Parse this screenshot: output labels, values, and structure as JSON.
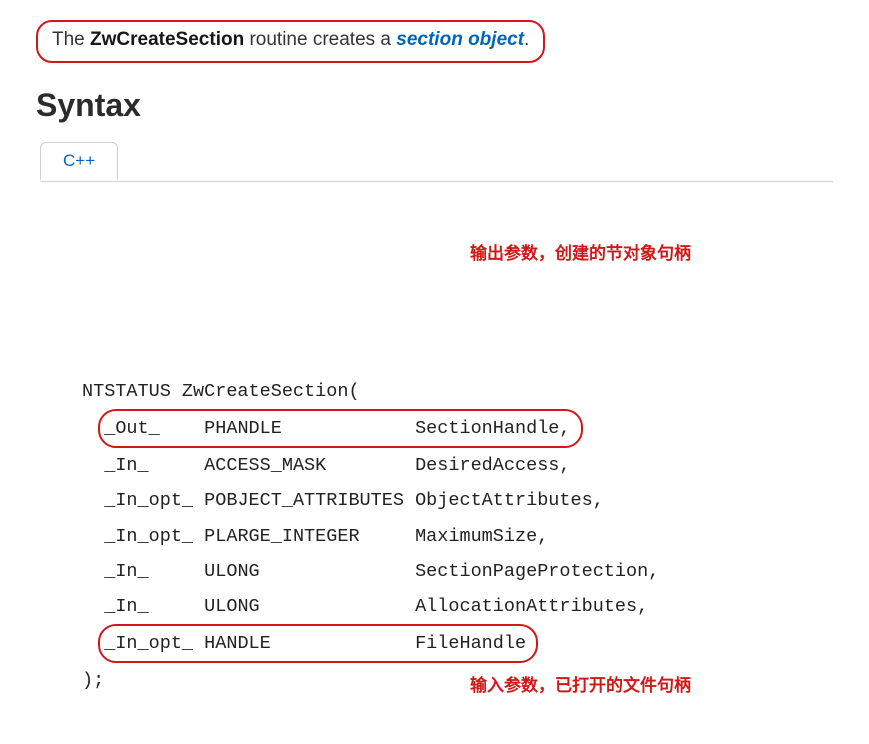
{
  "intro": {
    "pre": "The ",
    "api": "ZwCreateSection",
    "mid": " routine creates a ",
    "link": "section object",
    "post": "."
  },
  "syntax_heading": "Syntax",
  "tab": "C++",
  "sig": {
    "decl": "NTSTATUS ZwCreateSection(",
    "close": ");",
    "params": [
      {
        "annot": "_Out_   ",
        "type": "PHANDLE           ",
        "name": "SectionHandle,",
        "hl": true
      },
      {
        "annot": "_In_    ",
        "type": "ACCESS_MASK       ",
        "name": "DesiredAccess,",
        "hl": false
      },
      {
        "annot": "_In_opt_",
        "type": "POBJECT_ATTRIBUTES",
        "name": "ObjectAttributes,",
        "hl": false
      },
      {
        "annot": "_In_opt_",
        "type": "PLARGE_INTEGER    ",
        "name": "MaximumSize,",
        "hl": false
      },
      {
        "annot": "_In_    ",
        "type": "ULONG             ",
        "name": "SectionPageProtection,",
        "hl": false
      },
      {
        "annot": "_In_    ",
        "type": "ULONG             ",
        "name": "AllocationAttributes,",
        "hl": false
      },
      {
        "annot": "_In_opt_",
        "type": "HANDLE            ",
        "name": "FileHandle",
        "hl": true
      }
    ]
  },
  "annotations": {
    "top": "输出参数，创建的节对象句柄",
    "bottom": "输入参数，已打开的文件句柄"
  }
}
